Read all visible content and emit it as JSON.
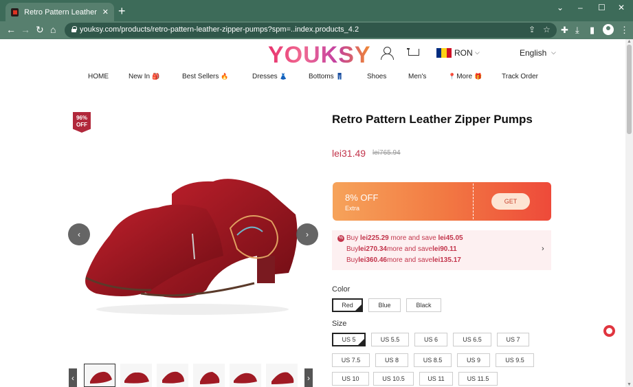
{
  "browser": {
    "tab_title": "Retro Pattern Leather Zipper Pumps",
    "url": "youksy.com/products/retro-pattern-leather-zipper-pumps?spm=..index.products_4.2"
  },
  "header": {
    "logo": "YOUKSY",
    "currency": "RON",
    "language": "English",
    "flag_colors": [
      "#002b7f",
      "#fcd116",
      "#ce1126"
    ]
  },
  "nav": {
    "items": [
      {
        "label": "HOME",
        "emoji": ""
      },
      {
        "label": "New In",
        "emoji": "🎒"
      },
      {
        "label": "Best Sellers",
        "emoji": "🔥"
      },
      {
        "label": "Dresses",
        "emoji": "👗"
      },
      {
        "label": "Bottoms",
        "emoji": "👖"
      },
      {
        "label": "Shoes",
        "emoji": ""
      },
      {
        "label": "Men's",
        "emoji": ""
      },
      {
        "label": "More",
        "emoji": "🎁",
        "prefix": "📍"
      },
      {
        "label": "Track Order",
        "emoji": ""
      }
    ]
  },
  "product": {
    "badge_line1": "96%",
    "badge_line2": "OFF",
    "title": "Retro Pattern Leather Zipper Pumps",
    "price": "lei31.49",
    "old_price": "lei765.94",
    "coupon": {
      "off": "8% OFF",
      "sub": "Extra",
      "button": "GET"
    },
    "promo": {
      "line1_pre": "Buy ",
      "line1_amount": "lei225.29",
      "line1_mid": " more and save ",
      "line1_save": "lei45.05",
      "line2_pre": "Buy",
      "line2_amount": "lei270.34",
      "line2_mid": "more and save",
      "line2_save": "lei90.11",
      "line3_pre": "Buy",
      "line3_amount": "lei360.46",
      "line3_mid": "more and save",
      "line3_save": "lei135.17"
    },
    "color_label": "Color",
    "colors": [
      "Red",
      "Blue",
      "Black"
    ],
    "selected_color": "Red",
    "size_label": "Size",
    "sizes": [
      "US 5",
      "US 5.5",
      "US 6",
      "US 6.5",
      "US 7",
      "US 7.5",
      "US 8",
      "US 8.5",
      "US 9",
      "US 9.5",
      "US 10",
      "US 10.5",
      "US 11",
      "US 11.5"
    ],
    "selected_size": "US 5",
    "thumbnail_count": 6
  },
  "colors": {
    "accent": "#c2334a",
    "chrome": "#577f6e",
    "coupon_start": "#f6a35a",
    "coupon_end": "#ee4a3a"
  }
}
